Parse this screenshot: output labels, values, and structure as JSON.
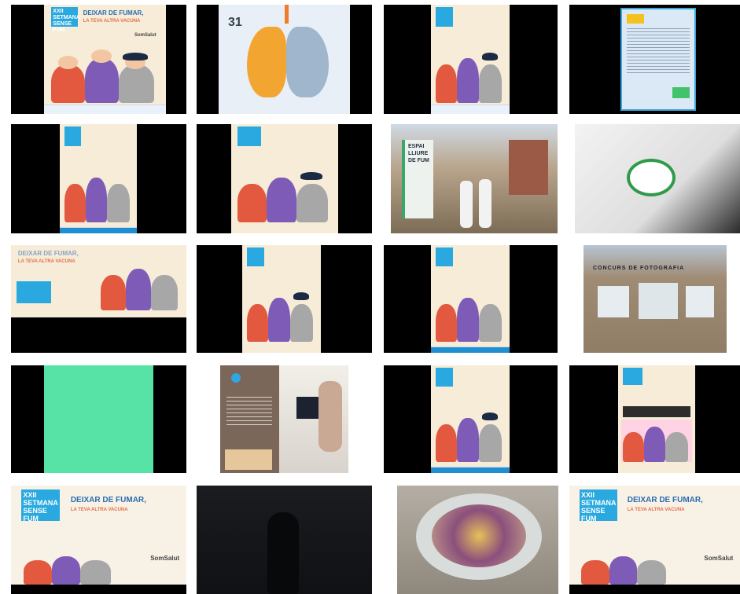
{
  "poster": {
    "badge": "XXII SETMANA SENSE FUM",
    "headline_1": "DEIXAR DE FUMAR,",
    "headline_2": "LA TEVA ALTRA VACUNA",
    "logo": "SomSalut"
  },
  "lungs": {
    "day": "31"
  },
  "sign": {
    "text": "ESPAI LLIURE DE FUM"
  },
  "gallery_sign": {
    "text": "CONCURS DE FOTOGRAFIA"
  },
  "colors": {
    "poster_bg": "#f6ecd8",
    "brand_blue": "#29a9df",
    "green_card": "#56e3a5"
  }
}
